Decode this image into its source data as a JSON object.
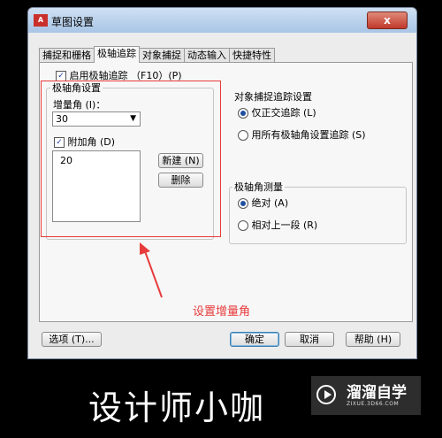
{
  "window": {
    "title": "草图设置",
    "app_icon": "A",
    "close_label": "x"
  },
  "tabs": [
    {
      "label": "捕捉和栅格",
      "active": false
    },
    {
      "label": "极轴追踪",
      "active": true
    },
    {
      "label": "对象捕捉",
      "active": false
    },
    {
      "label": "动态输入",
      "active": false
    },
    {
      "label": "快捷特性",
      "active": false
    }
  ],
  "polar": {
    "enable_label": "启用极轴追踪 （F10）(P)",
    "enable_checked": true,
    "angle_group_title": "极轴角设置",
    "increment_label": "增量角 (I)：",
    "increment_value": "30",
    "additional_label": "附加角 (D)",
    "additional_checked": true,
    "additional_angles": [
      "20"
    ],
    "new_button": "新建 (N)",
    "delete_button": "删除"
  },
  "tracking": {
    "title": "对象捕捉追踪设置",
    "options": [
      {
        "label": "仅正交追踪 (L)",
        "selected": true
      },
      {
        "label": "用所有极轴角设置追踪 (S)",
        "selected": false
      }
    ]
  },
  "measure": {
    "title": "极轴角测量",
    "options": [
      {
        "label": "绝对 (A)",
        "selected": true
      },
      {
        "label": "相对上一段 (R)",
        "selected": false
      }
    ]
  },
  "footer": {
    "options_button": "选项 (T)...",
    "ok_button": "确定",
    "cancel_button": "取消",
    "help_button": "帮助 (H)"
  },
  "annotation": "设置增量角",
  "watermark": {
    "caption": "设计师小咖",
    "logo_name": "溜溜自学",
    "logo_url": "ZIXUE.3D66.COM"
  },
  "colors": {
    "annotation_red": "#e83b3b",
    "selection_blue": "#1f4fa0"
  }
}
